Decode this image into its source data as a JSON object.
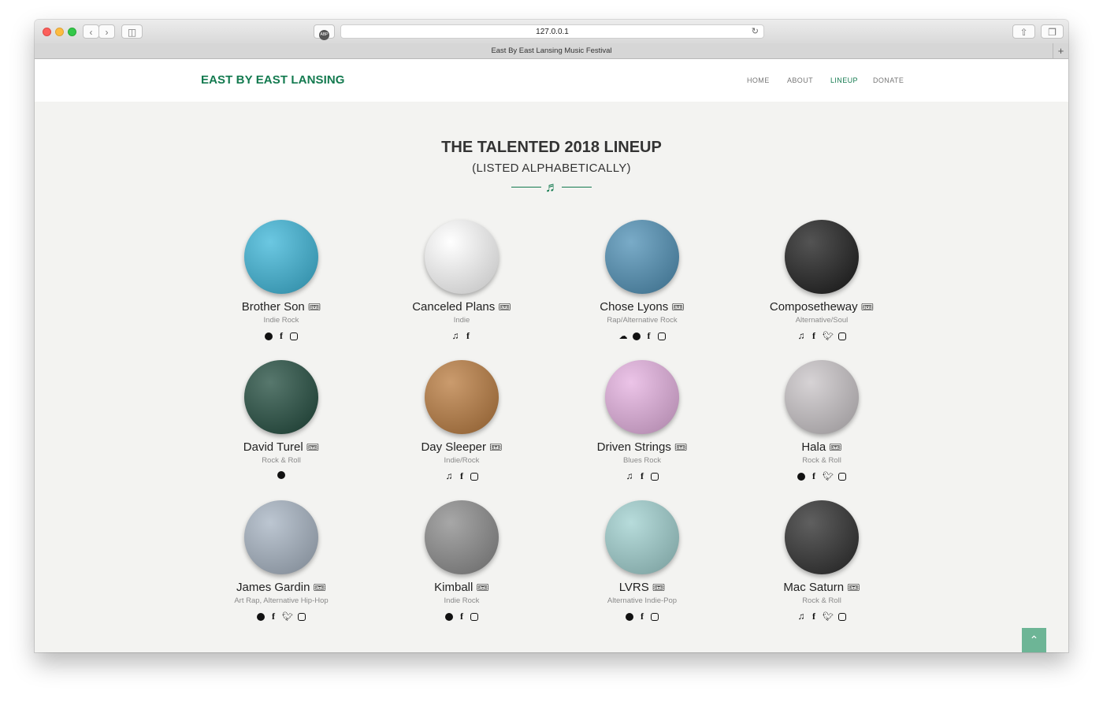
{
  "browser": {
    "url": "127.0.0.1",
    "tab_title": "East By East Lansing Music Festival",
    "adblock_label": "ABP",
    "new_tab_label": "+"
  },
  "nav": {
    "brand": "EAST BY EAST LANSING",
    "items": [
      {
        "label": "HOME",
        "active": false
      },
      {
        "label": "ABOUT",
        "active": false
      },
      {
        "label": "LINEUP",
        "active": true
      },
      {
        "label": "DONATE",
        "active": false
      }
    ]
  },
  "main": {
    "title": "THE TALENTED 2018 LINEUP",
    "subtitle": "(LISTED ALPHABETICALLY)"
  },
  "artists": [
    {
      "name": "Brother Son",
      "genre": "Indie Rock",
      "avatar_color": "#3ab5d8",
      "socials": [
        "spotify",
        "facebook",
        "instagram"
      ]
    },
    {
      "name": "Canceled Plans",
      "genre": "Indie",
      "avatar_color": "#ffffff",
      "socials": [
        "music",
        "facebook"
      ]
    },
    {
      "name": "Chose Lyons",
      "genre": "Rap/Alternative Rock",
      "avatar_color": "#4d8fb5",
      "socials": [
        "soundcloud",
        "spotify",
        "facebook",
        "instagram"
      ]
    },
    {
      "name": "Composetheway",
      "genre": "Alternative/Soul",
      "avatar_color": "#1a1a1a",
      "socials": [
        "music",
        "facebook",
        "twitter",
        "instagram"
      ]
    },
    {
      "name": "David Turel",
      "genre": "Rock & Roll",
      "avatar_color": "#1f4a3c",
      "socials": [
        "bandcamp"
      ]
    },
    {
      "name": "Day Sleeper",
      "genre": "Indie/Rock",
      "avatar_color": "#b97a3d",
      "socials": [
        "music",
        "facebook",
        "instagram"
      ]
    },
    {
      "name": "Driven Strings",
      "genre": "Blues Rock",
      "avatar_color": "#e5b0e0",
      "socials": [
        "music",
        "facebook",
        "instagram"
      ]
    },
    {
      "name": "Hala",
      "genre": "Rock & Roll",
      "avatar_color": "#c9c4c7",
      "socials": [
        "bandcamp",
        "facebook",
        "twitter",
        "instagram"
      ]
    },
    {
      "name": "James Gardin",
      "genre": "Art Rap, Alternative Hip-Hop",
      "avatar_color": "#a6b3c2",
      "socials": [
        "bandcamp",
        "facebook",
        "twitter",
        "instagram"
      ]
    },
    {
      "name": "Kimball",
      "genre": "Indie Rock",
      "avatar_color": "#8a8a8a",
      "socials": [
        "spotify",
        "facebook",
        "instagram"
      ]
    },
    {
      "name": "LVRS",
      "genre": "Alternative Indie-Pop",
      "avatar_color": "#9fd0cf",
      "socials": [
        "bandcamp",
        "facebook",
        "instagram"
      ]
    },
    {
      "name": "Mac Saturn",
      "genre": "Rock & Roll",
      "avatar_color": "#2a2a2a",
      "socials": [
        "music",
        "facebook",
        "twitter",
        "instagram"
      ]
    }
  ]
}
